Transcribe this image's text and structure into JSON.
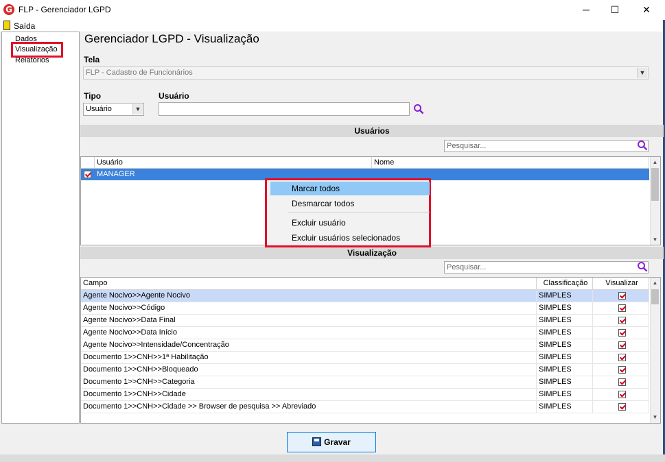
{
  "window": {
    "title": "FLP - Gerenciador LGPD",
    "app_icon": "G",
    "minimize": "─",
    "maximize": "☐",
    "close": "✕"
  },
  "menu": {
    "saida": "Saída"
  },
  "tree": {
    "items": [
      "Dados",
      "Visualização",
      "Relatórios"
    ],
    "selected": "Visualização"
  },
  "main": {
    "title": "Gerenciador LGPD - Visualização",
    "tela_label": "Tela",
    "tela_value": "FLP - Cadastro de Funcionários",
    "tipo_label": "Tipo",
    "tipo_value": "Usuário",
    "usuario_label": "Usuário",
    "usuario_value": ""
  },
  "usuarios": {
    "section_title": "Usuários",
    "search_placeholder": "Pesquisar...",
    "columns": [
      "Usuário",
      "Nome"
    ],
    "rows": [
      {
        "usuario": "MANAGER",
        "nome": "",
        "checked": true
      }
    ]
  },
  "context_menu": {
    "items": [
      "Marcar todos",
      "Desmarcar todos",
      "Excluir usuário",
      "Excluir usuários selecionados"
    ]
  },
  "visualizacao": {
    "section_title": "Visualização",
    "search_placeholder": "Pesquisar...",
    "columns": [
      "Campo",
      "Classificação",
      "Visualizar"
    ],
    "rows": [
      {
        "campo": "Agente Nocivo>>Agente Nocivo",
        "classificacao": "SIMPLES",
        "visualizar": true
      },
      {
        "campo": "Agente Nocivo>>Código",
        "classificacao": "SIMPLES",
        "visualizar": true
      },
      {
        "campo": "Agente Nocivo>>Data Final",
        "classificacao": "SIMPLES",
        "visualizar": true
      },
      {
        "campo": "Agente Nocivo>>Data Início",
        "classificacao": "SIMPLES",
        "visualizar": true
      },
      {
        "campo": "Agente Nocivo>>Intensidade/Concentração",
        "classificacao": "SIMPLES",
        "visualizar": true
      },
      {
        "campo": "Documento 1>>CNH>>1ª Habilitação",
        "classificacao": "SIMPLES",
        "visualizar": true
      },
      {
        "campo": "Documento 1>>CNH>>Bloqueado",
        "classificacao": "SIMPLES",
        "visualizar": true
      },
      {
        "campo": "Documento 1>>CNH>>Categoria",
        "classificacao": "SIMPLES",
        "visualizar": true
      },
      {
        "campo": "Documento 1>>CNH>>Cidade",
        "classificacao": "SIMPLES",
        "visualizar": true
      },
      {
        "campo": "Documento 1>>CNH>>Cidade >> Browser de pesquisa >> Abreviado",
        "classificacao": "SIMPLES",
        "visualizar": true
      }
    ]
  },
  "footer": {
    "gravar_label": "Gravar"
  },
  "colors": {
    "highlight_red": "#e0102a",
    "selection_blue": "#3b82dc",
    "row_selected": "#c9daf8",
    "search_icon": "#8a1fd1"
  }
}
